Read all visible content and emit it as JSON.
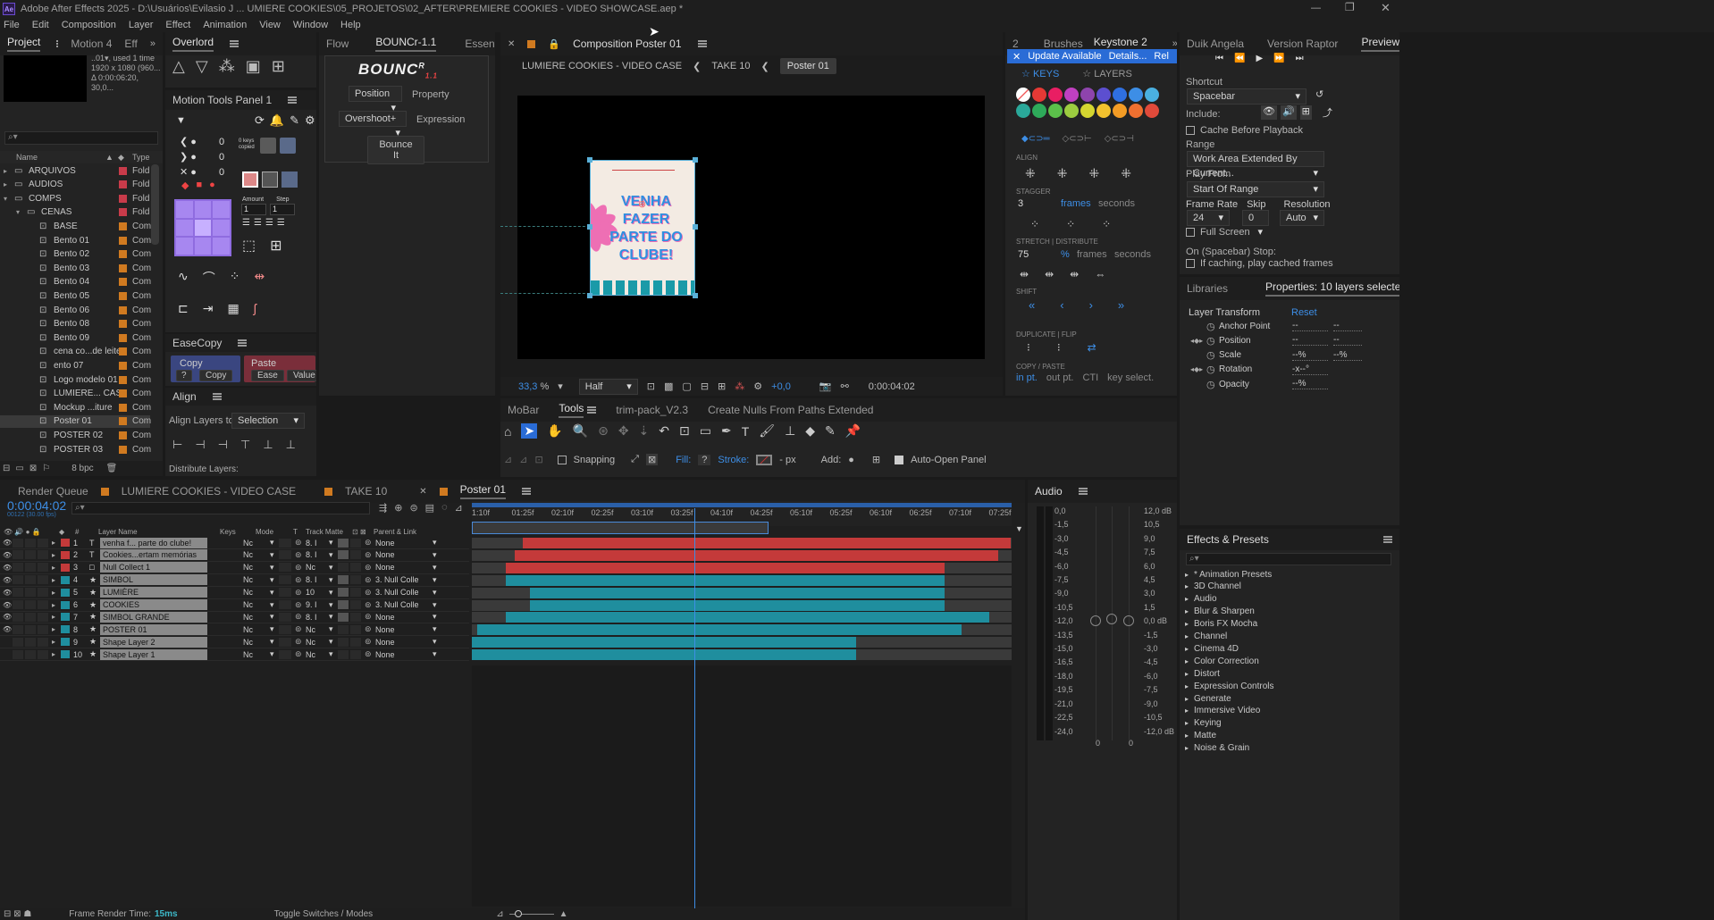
{
  "titlebar": {
    "app_icon": "Ae",
    "title": "Adobe After Effects 2025 - D:\\Usuários\\Evilasio J ... UMIERE COOKIES\\05_PROJETOS\\02_AFTER\\PREMIERE COOKIES - VIDEO SHOWCASE.aep *"
  },
  "menu": [
    "File",
    "Edit",
    "Composition",
    "Layer",
    "Effect",
    "Animation",
    "View",
    "Window",
    "Help"
  ],
  "project": {
    "tabs": [
      "Project",
      "Motion 4",
      "Eff"
    ],
    "info_lines": [
      "..01▾, used 1 time",
      "1920 x 1080 (960...",
      "Δ 0:00:06:20, 30,0..."
    ],
    "col_name": "Name",
    "col_type": "Type",
    "items": [
      {
        "name": "ARQUIVOS",
        "type": "Fold",
        "indent": 0,
        "folder": true,
        "color": "#c83b4a"
      },
      {
        "name": "AUDIOS",
        "type": "Fold",
        "indent": 0,
        "folder": true,
        "color": "#c83b4a"
      },
      {
        "name": "COMPS",
        "type": "Fold",
        "indent": 0,
        "folder": true,
        "color": "#c83b4a"
      },
      {
        "name": "CENAS",
        "type": "Fold",
        "indent": 1,
        "folder": true,
        "color": "#c83b4a"
      },
      {
        "name": "BASE",
        "type": "Com",
        "indent": 2,
        "color": "#d07a20"
      },
      {
        "name": "Bento 01",
        "type": "Com",
        "indent": 2,
        "color": "#d07a20"
      },
      {
        "name": "Bento 02",
        "type": "Com",
        "indent": 2,
        "color": "#d07a20"
      },
      {
        "name": "Bento 03",
        "type": "Com",
        "indent": 2,
        "color": "#d07a20"
      },
      {
        "name": "Bento 04",
        "type": "Com",
        "indent": 2,
        "color": "#d07a20"
      },
      {
        "name": "Bento 05",
        "type": "Com",
        "indent": 2,
        "color": "#d07a20"
      },
      {
        "name": "Bento 06",
        "type": "Com",
        "indent": 2,
        "color": "#d07a20"
      },
      {
        "name": "Bento 08",
        "type": "Com",
        "indent": 2,
        "color": "#d07a20"
      },
      {
        "name": "Bento 09",
        "type": "Com",
        "indent": 2,
        "color": "#d07a20"
      },
      {
        "name": "cena co...de leite",
        "type": "Com",
        "indent": 2,
        "color": "#d07a20"
      },
      {
        "name": "ento 07",
        "type": "Com",
        "indent": 2,
        "color": "#d07a20"
      },
      {
        "name": "Logo modelo 01",
        "type": "Com",
        "indent": 2,
        "color": "#d07a20"
      },
      {
        "name": "LUMIERE... CASE",
        "type": "Com",
        "indent": 2,
        "color": "#d07a20"
      },
      {
        "name": "Mockup ...iture",
        "type": "Com",
        "indent": 2,
        "color": "#d07a20"
      },
      {
        "name": "Poster 01",
        "type": "Com",
        "indent": 2,
        "color": "#d07a20",
        "selected": true
      },
      {
        "name": "POSTER 02",
        "type": "Com",
        "indent": 2,
        "color": "#d07a20"
      },
      {
        "name": "POSTER 03",
        "type": "Com",
        "indent": 2,
        "color": "#d07a20"
      }
    ],
    "bpc": "8 bpc"
  },
  "overlord": {
    "title": "Overlord"
  },
  "motion_tools": {
    "title": "Motion Tools Panel 1",
    "values": [
      "0",
      "0",
      "0"
    ],
    "keys_copied": "0 keys copied",
    "amount_label": "Amount",
    "step_label": "Step",
    "amount": "1",
    "step": "1"
  },
  "easecopy": {
    "title": "EaseCopy",
    "copy": "Copy",
    "paste": "Paste",
    "q": "?",
    "copy_btn": "Copy",
    "ease_btn": "Ease",
    "value_btn": "Value"
  },
  "align": {
    "title": "Align",
    "align_to_label": "Align Layers to:",
    "align_to": "Selection",
    "distribute": "Distribute Layers:"
  },
  "flow": {
    "tabs": [
      "Flow",
      "BOUNCr-1.1",
      "Essential"
    ],
    "logo": "BOUNC",
    "logo_sup": "R",
    "logo_ver": "1.1",
    "position": "Position",
    "property": "Property",
    "overshoot": "Overshoot+",
    "expression": "Expression",
    "bounce_it": "Bounce It"
  },
  "comp": {
    "tab": "Composition Poster 01",
    "breadcrumbs": [
      "LUMIERE COOKIES - VIDEO CASE",
      "TAKE 10",
      "Poster 01"
    ],
    "poster_text": "VENHA FAZER PARTE DO CLUBE!",
    "zoom": "33,3",
    "zoom_unit": "%",
    "resolution": "Half",
    "exposure": "+0,0",
    "timecode": "0:00:04:02"
  },
  "keystone": {
    "tabs": [
      "2",
      "Brushes",
      "Keystone 2"
    ],
    "update": "Update Available",
    "details": "Details...",
    "rel": "Rel",
    "keys": "KEYS",
    "layers": "LAYERS",
    "align_label": "ALIGN",
    "stagger_label": "STAGGER",
    "stagger_value": "3",
    "frames": "frames",
    "seconds": "seconds",
    "stretch_label": "STRETCH",
    "distribute_label": "DISTRIBUTE",
    "stretch_value": "75",
    "pct": "%",
    "shift_label": "SHIFT",
    "duplicate_label": "DUPLICATE",
    "flip_label": "FLIP",
    "copy_paste_label": "COPY / PASTE",
    "in_pt": "in pt.",
    "out_pt": "out pt.",
    "cti": "CTI",
    "key_select": "key select.",
    "swatches": [
      "#ffffff",
      "#e53935",
      "#e91e63",
      "#c040c0",
      "#8e44ad",
      "#5c4fd0",
      "#2f6fe0",
      "#3d8ee6",
      "#4ab0e0",
      "#2aa89a",
      "#2eaa5a",
      "#5bc04a",
      "#9ccc40",
      "#d4d630",
      "#f2c12e",
      "#f39c25",
      "#f07030",
      "#e04a3a"
    ]
  },
  "preview": {
    "tabs": [
      "Duik Angela",
      "Version Raptor",
      "Preview"
    ],
    "shortcut_label": "Shortcut",
    "shortcut": "Spacebar",
    "include_label": "Include:",
    "cache": "Cache Before Playback",
    "range_label": "Range",
    "range": "Work Area Extended By Current...",
    "play_from_label": "Play From",
    "play_from": "Start Of Range",
    "frame_rate_label": "Frame Rate",
    "skip_label": "Skip",
    "resolution_label": "Resolution",
    "frame_rate": "24",
    "skip": "0",
    "resolution": "Auto",
    "full_screen": "Full Screen",
    "stop_label": "On (Spacebar) Stop:",
    "stop_option": "If caching, play cached frames"
  },
  "properties": {
    "tabs": [
      "Libraries",
      "Properties: 10 layers selected"
    ],
    "section": "Layer Transform",
    "reset": "Reset",
    "rows": [
      {
        "name": "Anchor Point",
        "v1": "--",
        "v2": "--"
      },
      {
        "name": "Position",
        "v1": "--",
        "v2": "--"
      },
      {
        "name": "Scale",
        "v1": "--%",
        "v2": "--%"
      },
      {
        "name": "Rotation",
        "v1": "-x--°",
        "v2": ""
      },
      {
        "name": "Opacity",
        "v1": "--%",
        "v2": ""
      }
    ]
  },
  "effects": {
    "title": "Effects & Presets",
    "items": [
      "* Animation Presets",
      "3D Channel",
      "Audio",
      "Blur & Sharpen",
      "Boris FX Mocha",
      "Channel",
      "Cinema 4D",
      "Color Correction",
      "Distort",
      "Expression Controls",
      "Generate",
      "Immersive Video",
      "Keying",
      "Matte",
      "Noise & Grain"
    ]
  },
  "tools": {
    "tabs": [
      "MoBar",
      "Tools",
      "trim-pack_V2.3",
      "Create Nulls From Paths Extended"
    ],
    "snapping": "Snapping",
    "fill": "Fill:",
    "fill_q": "?",
    "stroke": "Stroke:",
    "px": "- px",
    "add": "Add:",
    "auto_open": "Auto-Open Panel"
  },
  "timeline": {
    "tabs": [
      "Render Queue",
      "LUMIERE COOKIES - VIDEO CASE",
      "TAKE 10",
      "Poster 01"
    ],
    "timecode": "0:00:04:02",
    "frame_info": "00122 (30.00 fps)",
    "headers": [
      "#",
      "Layer Name",
      "Keys",
      "Mode",
      "T",
      "Track Matte",
      "Parent & Link"
    ],
    "ruler": [
      "1:10f",
      "01:25f",
      "02:10f",
      "02:25f",
      "03:10f",
      "03:25f",
      "04:10f",
      "04:25f",
      "05:10f",
      "05:25f",
      "06:10f",
      "06:25f",
      "07:10f",
      "07:25f"
    ],
    "layers": [
      {
        "num": "1",
        "name": "venha f... parte do clube!",
        "kind": "T",
        "color": "#c43a3a",
        "mode": "Nc",
        "matte": "8. I",
        "parent": "None",
        "bar_color": "red",
        "start": 0.094,
        "end": 0.998
      },
      {
        "num": "2",
        "name": "Cookies...ertam memórias",
        "kind": "T",
        "color": "#c43a3a",
        "mode": "Nc",
        "matte": "8. I",
        "parent": "None",
        "bar_color": "red",
        "start": 0.08,
        "end": 0.975
      },
      {
        "num": "3",
        "name": "Null Collect 1",
        "kind": "null",
        "color": "#c43a3a",
        "mode": "Nc",
        "matte": "Nc",
        "parent": "None",
        "bar_color": "red",
        "start": 0.063,
        "end": 0.876
      },
      {
        "num": "4",
        "name": "SIMBOL",
        "kind": "shape",
        "color": "#1f8e9e",
        "mode": "Nc",
        "matte": "8. I",
        "parent": "3. Null Colle",
        "bar_color": "teal",
        "start": 0.063,
        "end": 0.876
      },
      {
        "num": "5",
        "name": "LUMIÈRE",
        "kind": "shape",
        "color": "#1f8e9e",
        "mode": "Nc",
        "matte": "10",
        "parent": "3. Null Colle",
        "bar_color": "teal",
        "start": 0.108,
        "end": 0.876
      },
      {
        "num": "6",
        "name": "COOKIES",
        "kind": "shape",
        "color": "#1f8e9e",
        "mode": "Nc",
        "matte": "9. I",
        "parent": "3. Null Colle",
        "bar_color": "teal",
        "start": 0.108,
        "end": 0.876
      },
      {
        "num": "7",
        "name": "SIMBOL GRANDE",
        "kind": "shape",
        "color": "#1f8e9e",
        "mode": "Nc",
        "matte": "8. I",
        "parent": "None",
        "bar_color": "teal",
        "start": 0.063,
        "end": 0.958
      },
      {
        "num": "8",
        "name": "POSTER 01",
        "kind": "shape",
        "color": "#1f8e9e",
        "mode": "Nc",
        "matte": "Nc",
        "parent": "None",
        "bar_color": "teal",
        "start": 0.01,
        "end": 0.908
      },
      {
        "num": "9",
        "name": "Shape Layer 2",
        "kind": "shape",
        "color": "#1f8e9e",
        "mode": "Nc",
        "matte": "Nc",
        "parent": "None",
        "bar_color": "teal",
        "start": 0.0,
        "end": 0.712
      },
      {
        "num": "10",
        "name": "Shape Layer 1",
        "kind": "shape",
        "color": "#1f8e9e",
        "mode": "Nc",
        "matte": "Nc",
        "parent": "None",
        "bar_color": "teal",
        "start": 0.0,
        "end": 0.712
      }
    ],
    "playhead": 0.413,
    "work_area_end": 0.55,
    "frame_render_label": "Frame Render Time:",
    "frame_render_value": "15ms",
    "toggle": "Toggle Switches / Modes"
  },
  "audio": {
    "title": "Audio",
    "left": [
      "0,0",
      "-1,5",
      "-3,0",
      "-4,5",
      "-6,0",
      "-7,5",
      "-9,0",
      "-10,5",
      "-12,0",
      "-13,5",
      "-15,0",
      "-16,5",
      "-18,0",
      "-19,5",
      "-21,0",
      "-22,5",
      "-24,0"
    ],
    "right": [
      "12,0 dB",
      "10,5",
      "9,0",
      "7,5",
      "6,0",
      "4,5",
      "3,0",
      "1,5",
      "0,0 dB",
      "-1,5",
      "-3,0",
      "-4,5",
      "-6,0",
      "-7,5",
      "-9,0",
      "-10,5",
      "-12,0 dB"
    ],
    "bottom": [
      "0",
      "0"
    ]
  }
}
